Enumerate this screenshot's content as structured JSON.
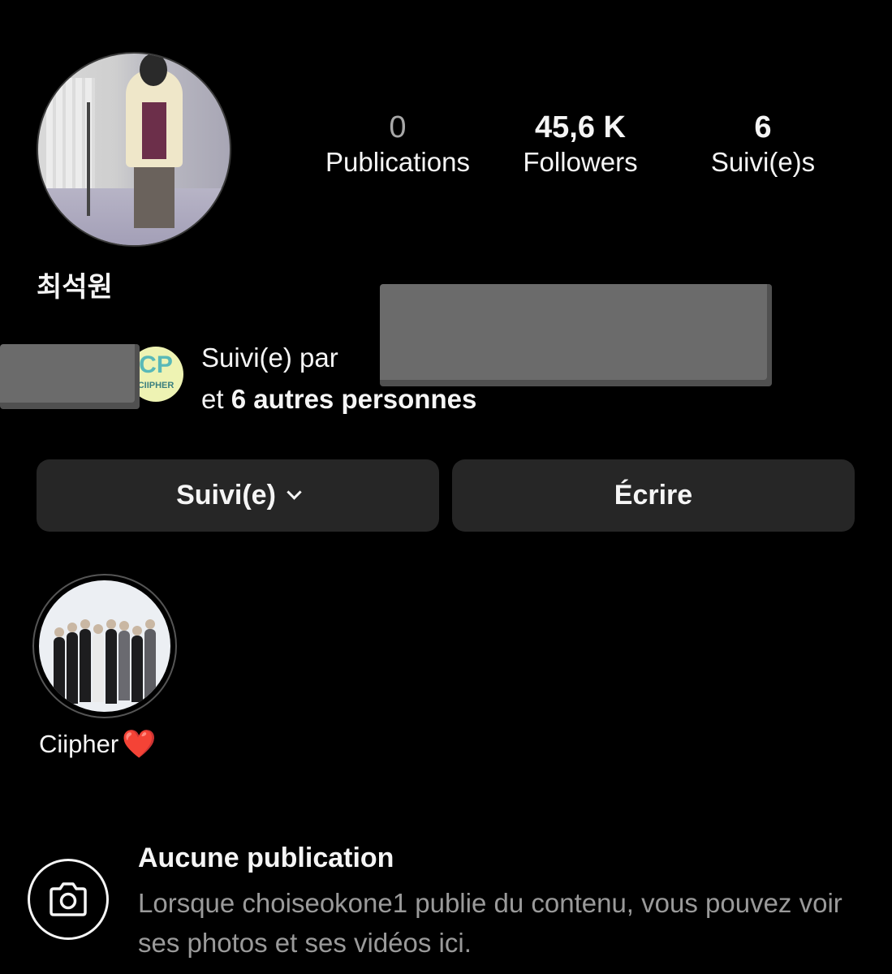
{
  "profile": {
    "display_name": "최석원",
    "username": "choiseokone1"
  },
  "stats": {
    "posts": {
      "value": "0",
      "label": "Publications"
    },
    "followers": {
      "value": "45,6 K",
      "label": "Followers"
    },
    "following": {
      "value": "6",
      "label": "Suivi(e)s"
    }
  },
  "followed_by": {
    "line1": "Suivi(e) par",
    "line2_prefix": "et ",
    "line2_bold": "6 autres personnes",
    "mutual_avatar_text": "CP",
    "mutual_avatar_subtext": "CIIPHER"
  },
  "actions": {
    "follow_label": "Suivi(e)",
    "message_label": "Écrire"
  },
  "highlight": {
    "label": "Ciipher",
    "emoji": "❤️"
  },
  "empty_state": {
    "title": "Aucune publication",
    "description": "Lorsque choiseokone1 publie du contenu, vous pouvez voir ses photos et ses vidéos ici."
  },
  "icons": {
    "camera": "camera-icon",
    "chevron": "chevron-down-icon"
  },
  "colors": {
    "background": "#000000",
    "button_bg": "#262626",
    "text": "#f5f5f5",
    "muted_text": "#9a9a9a",
    "redaction": "#6b6b6b",
    "heart": "#e0262f"
  }
}
